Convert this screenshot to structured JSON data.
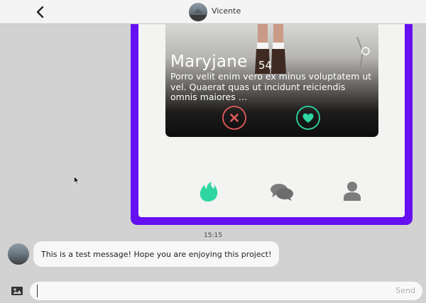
{
  "header": {
    "contact_name": "Vicente",
    "back_icon": "chevron-left-icon"
  },
  "shared_screenshot": {
    "card": {
      "name": "Maryjane",
      "age": "54",
      "bio": "Porro velit enim vero ex minus voluptatem ut vel. Quaerat quas ut incidunt reiciendis omnis maiores …"
    },
    "colors": {
      "frame": "#6510f0",
      "dislike": "#e25c5c",
      "like": "#2fd6a2",
      "flame": "#2fd6a2"
    },
    "nav_icons": [
      "flame-icon",
      "chat-bubbles-icon",
      "profile-icon"
    ]
  },
  "conversation": {
    "timestamp": "15:15",
    "messages": [
      {
        "text": "This is a test message! Hope you are enjoying this project!"
      }
    ]
  },
  "composer": {
    "value": "",
    "placeholder": "",
    "send_label": "Send",
    "image_icon": "image-icon"
  }
}
